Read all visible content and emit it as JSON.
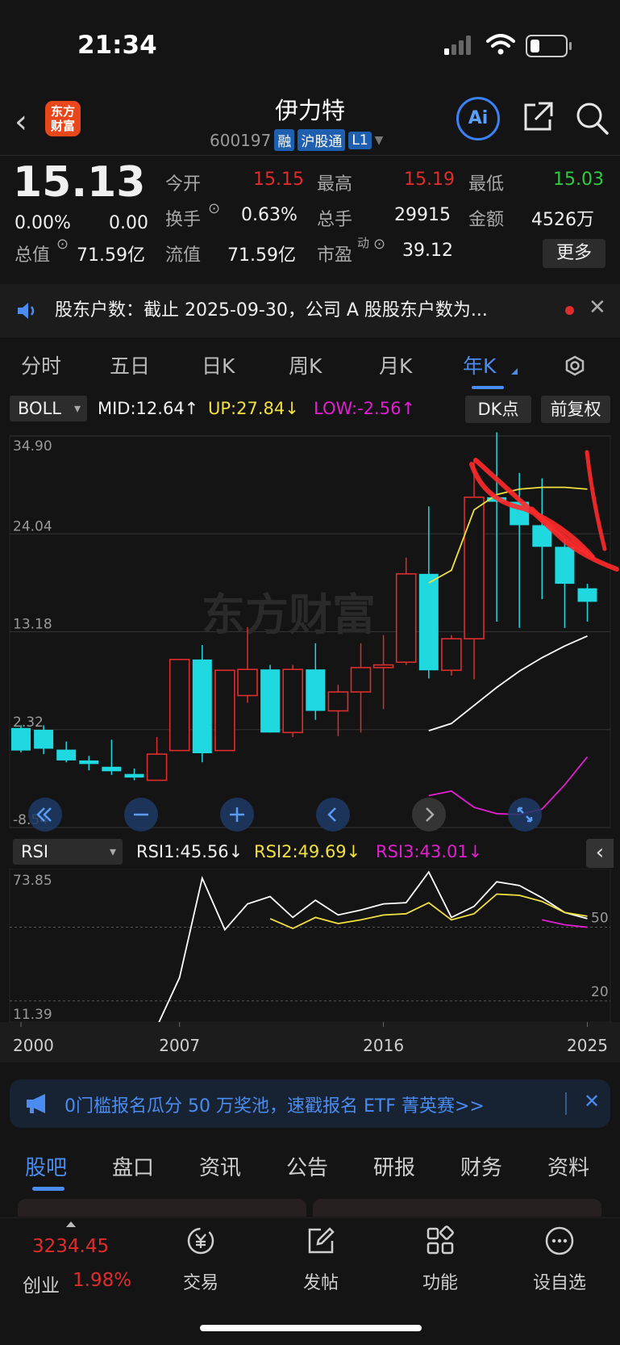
{
  "status_bar": {
    "time": "21:34"
  },
  "header": {
    "logo": "东方财富",
    "name": "伊力特",
    "code": "600197",
    "tags": [
      "融",
      "沪股通",
      "L1"
    ],
    "ai_label": "Ai"
  },
  "quote": {
    "price": "15.13",
    "change_pct": "0.00%",
    "change": "0.00",
    "open_label": "今开",
    "open": "15.15",
    "high_label": "最高",
    "high": "15.19",
    "low_label": "最低",
    "low": "15.03",
    "turnover_label": "换手",
    "turnover": "0.63%",
    "volume_label": "总手",
    "volume": "29915",
    "amount_label": "金额",
    "amount": "4526万",
    "mktcap_label": "总值",
    "mktcap": "71.59亿",
    "float_label": "流值",
    "float": "71.59亿",
    "pe_label": "市盈",
    "pe_sup": "动",
    "pe": "39.12",
    "more_label": "更多"
  },
  "news": {
    "text": "股东户数：截止 2025-09-30，公司 A 股股东户数为..."
  },
  "period_tabs": [
    {
      "label": "分时"
    },
    {
      "label": "五日"
    },
    {
      "label": "日K"
    },
    {
      "label": "周K"
    },
    {
      "label": "月K"
    },
    {
      "label": "年K"
    }
  ],
  "indicator_bar": {
    "name": "BOLL",
    "mid": "MID:12.64↑",
    "up": "UP:27.84↓",
    "low": "LOW:-2.56↑",
    "dk_label": "DK点",
    "adjust_label": "前复权"
  },
  "rsi_bar": {
    "name": "RSI",
    "rsi1": "RSI1:45.56↓",
    "rsi2": "RSI2:49.69↓",
    "rsi3": "RSI3:43.01↓"
  },
  "colors": {
    "up": "#e02c2c",
    "down": "#20d8e0",
    "accent": "#4a8cf0",
    "bg": "#141414"
  },
  "chart_data": [
    {
      "type": "candlestick",
      "title": "",
      "yticks": [
        "34.90",
        "24.04",
        "13.18",
        "2.32",
        "-8.54"
      ],
      "ylim": [
        -8.54,
        34.9
      ],
      "watermark": "东方财富",
      "candles": [
        {
          "o": 2.5,
          "h": 2.8,
          "l": -0.2,
          "c": 0.0
        },
        {
          "o": 2.3,
          "h": 2.8,
          "l": -0.4,
          "c": 0.2
        },
        {
          "o": 0.1,
          "h": 1.0,
          "l": -1.3,
          "c": -1.1
        },
        {
          "o": -1.1,
          "h": -0.6,
          "l": -2.2,
          "c": -1.5
        },
        {
          "o": -1.8,
          "h": 1.2,
          "l": -2.7,
          "c": -2.3
        },
        {
          "o": -2.6,
          "h": -2.0,
          "l": -3.3,
          "c": -3.0
        },
        {
          "o": -3.3,
          "h": 1.5,
          "l": -3.3,
          "c": -0.4
        },
        {
          "o": 0.0,
          "h": 10.1,
          "l": 0.0,
          "c": 10.1
        },
        {
          "o": 10.1,
          "h": 11.7,
          "l": -1.3,
          "c": -0.3
        },
        {
          "o": 0.0,
          "h": 8.9,
          "l": 0.0,
          "c": 8.9
        },
        {
          "o": 6.1,
          "h": 13.7,
          "l": 5.3,
          "c": 9.0
        },
        {
          "o": 9.0,
          "h": 9.5,
          "l": 2.0,
          "c": 2.0
        },
        {
          "o": 2.0,
          "h": 9.5,
          "l": 1.5,
          "c": 9.0
        },
        {
          "o": 9.0,
          "h": 11.9,
          "l": 3.4,
          "c": 4.4
        },
        {
          "o": 4.4,
          "h": 7.3,
          "l": 1.6,
          "c": 6.5
        },
        {
          "o": 6.5,
          "h": 11.9,
          "l": 2.0,
          "c": 9.2
        },
        {
          "o": 9.2,
          "h": 12.8,
          "l": 4.6,
          "c": 9.5
        },
        {
          "o": 9.8,
          "h": 21.4,
          "l": 9.5,
          "c": 19.6
        },
        {
          "o": 19.6,
          "h": 27.1,
          "l": 8.0,
          "c": 8.9
        },
        {
          "o": 8.9,
          "h": 12.8,
          "l": 8.3,
          "c": 12.4
        },
        {
          "o": 12.4,
          "h": 32.3,
          "l": 7.9,
          "c": 28.1
        },
        {
          "o": 28.1,
          "h": 35.3,
          "l": 14.3,
          "c": 27.6
        },
        {
          "o": 27.6,
          "h": 30.8,
          "l": 13.6,
          "c": 25.0
        },
        {
          "o": 25.0,
          "h": 30.2,
          "l": 16.8,
          "c": 22.6
        },
        {
          "o": 22.6,
          "h": 23.4,
          "l": 13.6,
          "c": 18.5
        },
        {
          "o": 18.0,
          "h": 18.5,
          "l": 14.3,
          "c": 16.5
        }
      ],
      "mid_line": [
        null,
        null,
        null,
        null,
        null,
        null,
        null,
        null,
        null,
        null,
        null,
        null,
        null,
        null,
        null,
        null,
        null,
        null,
        null,
        null,
        null,
        null,
        null,
        null,
        null,
        null
      ],
      "series": [
        {
          "color": "#f0e040",
          "values": [
            null,
            null,
            null,
            null,
            null,
            null,
            null,
            null,
            null,
            null,
            null,
            null,
            null,
            null,
            null,
            null,
            null,
            null,
            18.6,
            20.0,
            26.7,
            28.4,
            29.0,
            29.2,
            29.2,
            29.0
          ]
        },
        {
          "color": "#ffffff",
          "values": [
            null,
            null,
            null,
            null,
            null,
            null,
            null,
            null,
            null,
            null,
            null,
            null,
            null,
            null,
            null,
            null,
            null,
            null,
            2.2,
            3.0,
            5.0,
            7.0,
            8.8,
            10.3,
            11.6,
            12.7
          ]
        },
        {
          "color": "#e020d0",
          "values": [
            null,
            null,
            null,
            null,
            null,
            null,
            null,
            null,
            null,
            null,
            null,
            null,
            null,
            null,
            null,
            null,
            null,
            null,
            -5.0,
            -4.5,
            -6.3,
            -7.0,
            -7.1,
            -6.5,
            -3.8,
            -0.7
          ]
        }
      ]
    },
    {
      "type": "line",
      "title": "",
      "yticks": [
        "73.85",
        "11.39"
      ],
      "ref_lines": [
        "50",
        "20"
      ],
      "ylim": [
        11.39,
        73.85
      ],
      "xticks": [
        "2000",
        "2007",
        "2016",
        "2025"
      ],
      "series": [
        {
          "color": "#ffffff",
          "values": [
            null,
            null,
            null,
            null,
            null,
            9.7,
            9.5,
            29.5,
            70.0,
            49.0,
            59.5,
            62.5,
            54.0,
            61.0,
            55.0,
            57.0,
            59.5,
            60.0,
            72.5,
            54.0,
            58.5,
            68.5,
            67.0,
            62.0,
            56.0,
            53.5
          ]
        },
        {
          "color": "#f0e040",
          "values": [
            null,
            null,
            null,
            null,
            null,
            null,
            null,
            null,
            null,
            null,
            null,
            53.5,
            49.5,
            54.0,
            51.5,
            53.0,
            55.0,
            55.5,
            60.0,
            53.0,
            55.5,
            63.5,
            63.0,
            60.5,
            56.0,
            54.5
          ]
        },
        {
          "color": "#e020d0",
          "values": [
            null,
            null,
            null,
            null,
            null,
            null,
            null,
            null,
            null,
            null,
            null,
            null,
            null,
            null,
            null,
            null,
            null,
            null,
            null,
            null,
            null,
            null,
            null,
            53.0,
            51.0,
            50.0
          ]
        }
      ]
    }
  ],
  "chart_tools": [
    "rewind-icon",
    "zoom-out-icon",
    "zoom-in-icon",
    "prev-icon",
    "next-icon",
    "fullscreen-icon"
  ],
  "banner": {
    "text": "0门槛报名瓜分 50 万奖池，速戳报名 ETF 菁英赛>>"
  },
  "bottom_tabs": [
    {
      "label": "股吧"
    },
    {
      "label": "盘口"
    },
    {
      "label": "资讯"
    },
    {
      "label": "公告"
    },
    {
      "label": "研报"
    },
    {
      "label": "财务"
    },
    {
      "label": "资料"
    }
  ],
  "bottom_nav": {
    "index_value": "3234.45",
    "index_name": "创业",
    "index_change": "1.98%",
    "items": [
      {
        "label": "交易"
      },
      {
        "label": "发帖"
      },
      {
        "label": "功能"
      },
      {
        "label": "设自选"
      }
    ]
  }
}
